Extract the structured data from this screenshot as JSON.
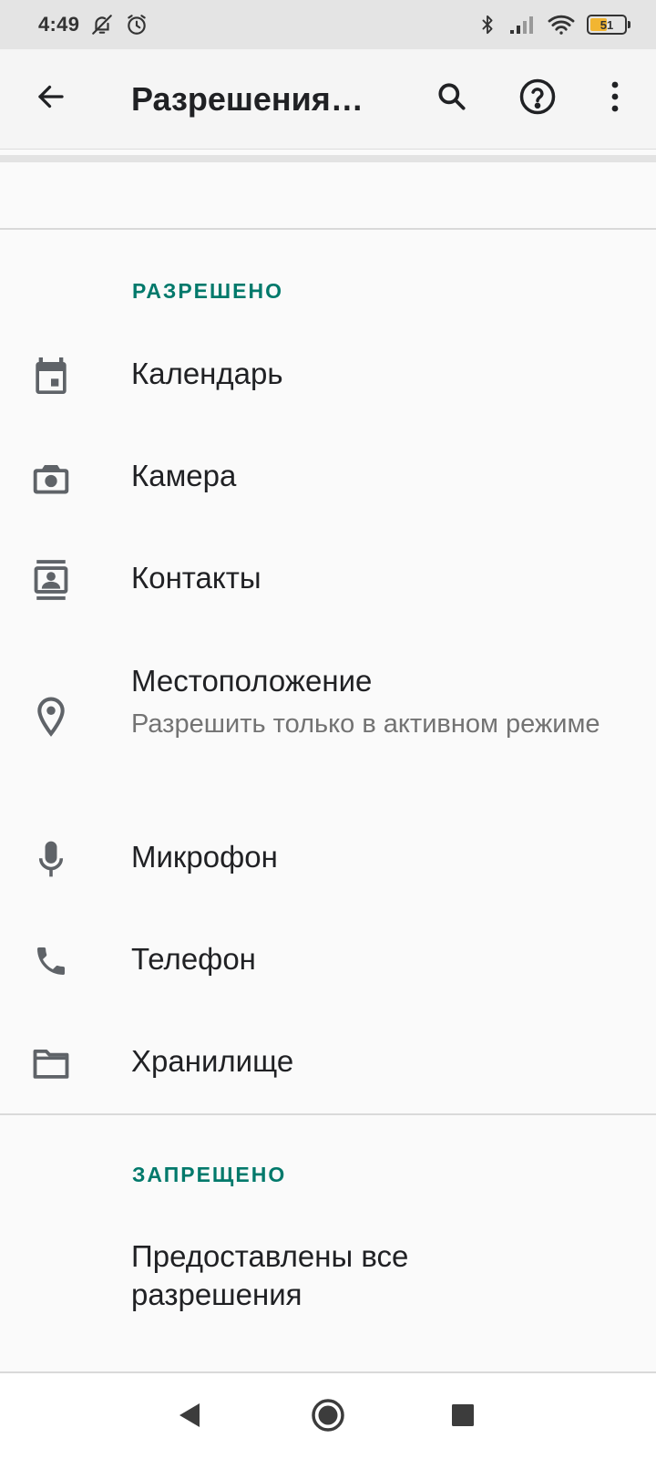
{
  "status_bar": {
    "time": "4:49",
    "battery_level": "51",
    "battery_fraction": 0.51,
    "icons": [
      "notifications-off-icon",
      "alarm-icon",
      "bluetooth-icon",
      "cell-signal-icon",
      "wifi-icon",
      "battery-icon"
    ]
  },
  "app_bar": {
    "title": "Разрешения…",
    "icons": [
      "back-arrow-icon",
      "search-icon",
      "help-icon",
      "more-vert-icon"
    ]
  },
  "sections": {
    "allowed": {
      "header": "РАЗРЕШЕНО",
      "items": [
        {
          "label": "Календарь",
          "icon": "calendar-icon"
        },
        {
          "label": "Камера",
          "icon": "camera-icon"
        },
        {
          "label": "Контакты",
          "icon": "contacts-icon"
        },
        {
          "label": "Местоположение",
          "subtitle": "Разрешить только в активном режиме",
          "icon": "location-icon"
        },
        {
          "label": "Микрофон",
          "icon": "microphone-icon"
        },
        {
          "label": "Телефон",
          "icon": "phone-icon"
        },
        {
          "label": "Хранилище",
          "icon": "folder-icon"
        }
      ]
    },
    "denied": {
      "header": "ЗАПРЕЩЕНО",
      "empty_text": "Предоставлены все разрешения"
    }
  },
  "nav_bar": {
    "icons": [
      "nav-back-icon",
      "nav-home-icon",
      "nav-recents-icon"
    ]
  },
  "colors": {
    "accent": "#00796b",
    "text_primary": "#202124",
    "text_secondary": "#737373",
    "icon": "#5f6368",
    "battery_fill": "#f2b531"
  }
}
